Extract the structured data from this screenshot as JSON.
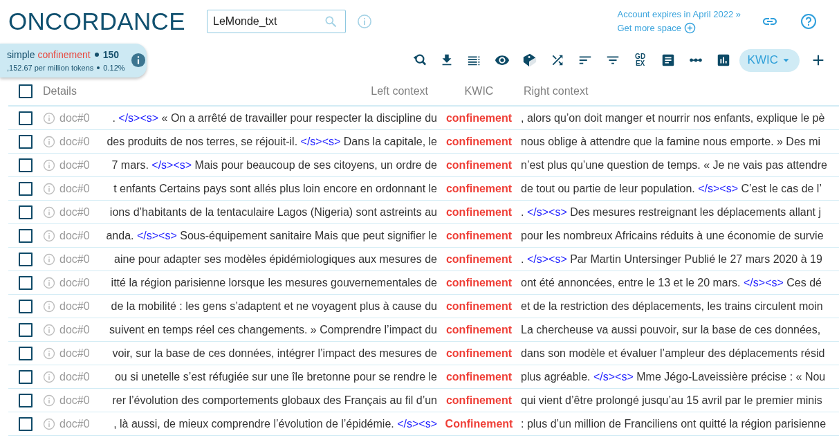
{
  "header": {
    "title": "ONCORDANCE",
    "search": {
      "value": "LeMonde_txt"
    },
    "account_link": "Account expires in April 2022 »",
    "space_link": "Get more space"
  },
  "summary": {
    "query_type": "simple",
    "query": "confinement",
    "hits": "150",
    "frequency": ",152.67 per million tokens",
    "percentage": "0.12%"
  },
  "toolbar": {
    "gdex_label": [
      "GD",
      "EX"
    ],
    "view_menu": "KWIC"
  },
  "table": {
    "all_selected": false,
    "columns": [
      "Details",
      "Left context",
      "KWIC",
      "Right context"
    ],
    "rows": [
      {
        "selected": false,
        "doc": "doc#0",
        "left": [
          {
            "kind": "text",
            "text": "."
          },
          {
            "kind": "tag",
            "text": "</s><s>"
          },
          {
            "kind": "text",
            "text": "« On a arrêté de travailler pour respecter la discipline du"
          }
        ],
        "kwic": "confinement",
        "right": [
          {
            "kind": "text",
            "text": ", alors qu’on doit manger et nourrir nos enfants, explique le pè"
          }
        ]
      },
      {
        "selected": false,
        "doc": "doc#0",
        "left": [
          {
            "kind": "text",
            "text": "des produits de nos terres, se réjouit-il."
          },
          {
            "kind": "tag",
            "text": "</s><s>"
          },
          {
            "kind": "text",
            "text": "Dans la capitale, le"
          }
        ],
        "kwic": "confinement",
        "right": [
          {
            "kind": "text",
            "text": "nous oblige à attendre que la famine nous emporte. » Des mi"
          }
        ]
      },
      {
        "selected": false,
        "doc": "doc#0",
        "left": [
          {
            "kind": "text",
            "text": "7 mars."
          },
          {
            "kind": "tag",
            "text": "</s><s>"
          },
          {
            "kind": "text",
            "text": "Mais pour beaucoup de ses citoyens, un ordre de"
          }
        ],
        "kwic": "confinement",
        "right": [
          {
            "kind": "text",
            "text": "n’est plus qu’une question de temps. « Je ne vais pas attendre"
          }
        ]
      },
      {
        "selected": false,
        "doc": "doc#0",
        "left": [
          {
            "kind": "text",
            "text": "t enfants Certains pays sont allés plus loin encore en ordonnant le"
          }
        ],
        "kwic": "confinement",
        "right": [
          {
            "kind": "text",
            "text": "de tout ou partie de leur population."
          },
          {
            "kind": "tag",
            "text": "</s><s>"
          },
          {
            "kind": "text",
            "text": "C’est le cas de l’"
          }
        ]
      },
      {
        "selected": false,
        "doc": "doc#0",
        "left": [
          {
            "kind": "text",
            "text": "ions d’habitants de la tentaculaire Lagos (Nigeria) sont astreints au"
          }
        ],
        "kwic": "confinement",
        "right": [
          {
            "kind": "text",
            "text": "."
          },
          {
            "kind": "tag",
            "text": "</s><s>"
          },
          {
            "kind": "text",
            "text": "Des mesures restreignant les déplacements allant j"
          }
        ]
      },
      {
        "selected": false,
        "doc": "doc#0",
        "left": [
          {
            "kind": "text",
            "text": "anda."
          },
          {
            "kind": "tag",
            "text": "</s><s>"
          },
          {
            "kind": "text",
            "text": "Sous-équipement sanitaire Mais que peut signifier le"
          }
        ],
        "kwic": "confinement",
        "right": [
          {
            "kind": "text",
            "text": "pour les nombreux Africains réduits à une économie de survie"
          }
        ]
      },
      {
        "selected": false,
        "doc": "doc#0",
        "left": [
          {
            "kind": "text",
            "text": "aine pour adapter ses modèles épidémiologiques aux mesures de"
          }
        ],
        "kwic": "confinement",
        "right": [
          {
            "kind": "text",
            "text": "."
          },
          {
            "kind": "tag",
            "text": "</s><s>"
          },
          {
            "kind": "text",
            "text": "Par Martin Untersinger Publié le 27 mars 2020 à 19"
          }
        ]
      },
      {
        "selected": false,
        "doc": "doc#0",
        "left": [
          {
            "kind": "text",
            "text": "itté la région parisienne lorsque les mesures gouvernementales de"
          }
        ],
        "kwic": "confinement",
        "right": [
          {
            "kind": "text",
            "text": "ont été annoncées, entre le 13 et le 20 mars."
          },
          {
            "kind": "tag",
            "text": "</s><s>"
          },
          {
            "kind": "text",
            "text": "Ces dé"
          }
        ]
      },
      {
        "selected": false,
        "doc": "doc#0",
        "left": [
          {
            "kind": "text",
            "text": "de la mobilité : les gens s’adaptent et ne voyagent plus à cause du"
          }
        ],
        "kwic": "confinement",
        "right": [
          {
            "kind": "text",
            "text": "et de la restriction des déplacements, les trains circulent moin"
          }
        ]
      },
      {
        "selected": false,
        "doc": "doc#0",
        "left": [
          {
            "kind": "text",
            "text": "suivent en temps réel ces changements. » Comprendre l’impact du"
          }
        ],
        "kwic": "confinement",
        "right": [
          {
            "kind": "text",
            "text": "La chercheuse va aussi pouvoir, sur la base de ces données,"
          }
        ]
      },
      {
        "selected": false,
        "doc": "doc#0",
        "left": [
          {
            "kind": "text",
            "text": "voir, sur la base de ces données, intégrer l’impact des mesures de"
          }
        ],
        "kwic": "confinement",
        "right": [
          {
            "kind": "text",
            "text": "dans son modèle et évaluer l’ampleur des déplacements résid"
          }
        ]
      },
      {
        "selected": false,
        "doc": "doc#0",
        "left": [
          {
            "kind": "text",
            "text": "ou si unetelle s’est réfugiée sur une île bretonne pour se rendre le"
          }
        ],
        "kwic": "confinement",
        "right": [
          {
            "kind": "text",
            "text": "plus agréable."
          },
          {
            "kind": "tag",
            "text": "</s><s>"
          },
          {
            "kind": "text",
            "text": "Mme Jégo-Laveissière précise : « Nou"
          }
        ]
      },
      {
        "selected": false,
        "doc": "doc#0",
        "left": [
          {
            "kind": "text",
            "text": "rer l’évolution des comportements globaux des Français au fil d’un"
          }
        ],
        "kwic": "confinement",
        "right": [
          {
            "kind": "text",
            "text": "qui vient d’être prolongé jusqu’au 15 avril par le premier minis"
          }
        ]
      },
      {
        "selected": false,
        "doc": "doc#0",
        "left": [
          {
            "kind": "text",
            "text": ", là aussi, de mieux comprendre l’évolution de l’épidémie."
          },
          {
            "kind": "tag",
            "text": "</s><s>"
          }
        ],
        "kwic": "Confinement",
        "right": [
          {
            "kind": "text",
            "text": ": plus d’un million de Franciliens ont quitté la région parisienne"
          }
        ]
      }
    ]
  }
}
